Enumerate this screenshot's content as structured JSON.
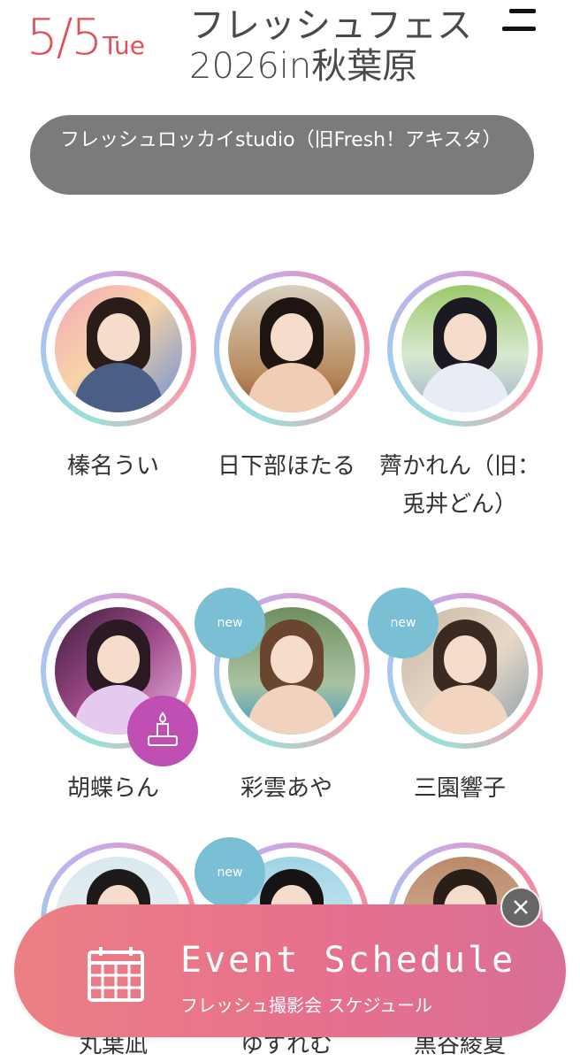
{
  "header": {
    "date_md": "5/5",
    "date_dow": "Tue",
    "title": "フレッシュフェス2026in秋葉原",
    "menu_icon": "hamburger-menu-icon"
  },
  "venue": {
    "label": "フレッシュロッカイstudio（旧Fresh！アキスタ）"
  },
  "models": [
    {
      "name": "榛名うい",
      "badge": ""
    },
    {
      "name": "日下部ほたる",
      "badge": ""
    },
    {
      "name": "薺かれん（旧：兎丼どん）",
      "badge": ""
    },
    {
      "name": "胡蝶らん",
      "badge": "cake-icon"
    },
    {
      "name": "彩雲あや",
      "badge": "new"
    },
    {
      "name": "三園響子",
      "badge": "new"
    },
    {
      "name": "丸葉凪",
      "badge": ""
    },
    {
      "name": "ゆずれむ",
      "badge": "new"
    },
    {
      "name": "黒谷綾夏",
      "badge": ""
    }
  ],
  "badges": {
    "new_label": "new"
  },
  "event_bar": {
    "title": "Event Schedule",
    "subtitle": "フレッシュ撮影会 スケジュール",
    "icon": "calendar-icon",
    "close_icon": "close-icon"
  },
  "colors": {
    "date_red": "#e2505a",
    "venue_pill": "#7b7b7b",
    "new_badge": "#7bbfd4",
    "cake_badge": "#c04fb4",
    "event_bar_start": "#ec7f84",
    "event_bar_end": "#d86f97"
  }
}
